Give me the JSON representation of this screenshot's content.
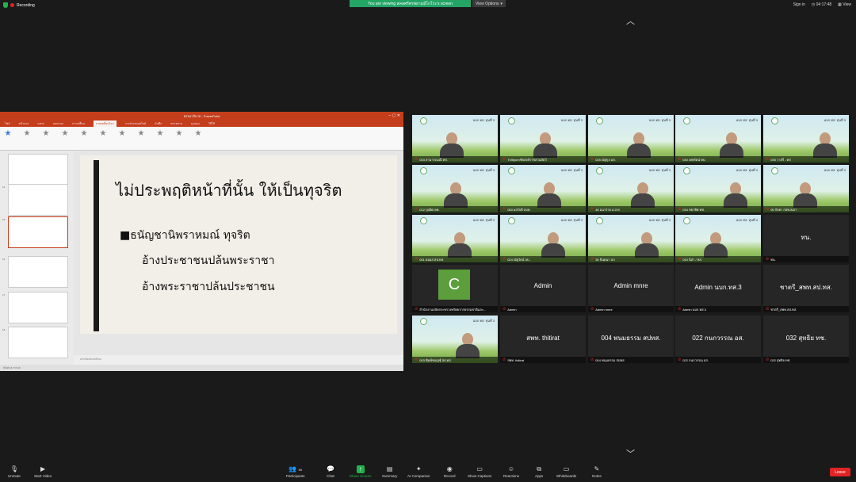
{
  "topbar": {
    "recording": "Recording",
    "viewing": "You are viewing สคสศรีศรพยามมีโกโร่ะ's screen",
    "view_options": "View Options",
    "sign_in": "Sign in",
    "time": "04:17:48",
    "view": "View"
  },
  "ppt": {
    "title": "ธรรมาภิบาล - PowerPoint",
    "tabs": [
      "ไฟล์",
      "หน้าแรก",
      "แทรก",
      "ออกแบบ",
      "การเปลี่ยน",
      "ภาพเคลื่อนไหว",
      "การนำเสนอสไลด์",
      "บันทึก",
      "ตรวจทาน",
      "มุมมอง",
      "วิธีใช้"
    ],
    "active_tab": "ภาพเคลื่อนไหว",
    "thumb_nums": [
      "14",
      "15",
      "16",
      "17",
      "18"
    ],
    "slide_title": "ไม่ประพฤติหน้าที่นั้น ให้เป็นทุจริต",
    "line1": "■ธนัญชานิพราหมณ์ ทุจริต",
    "line2": "อ้างประชาชนปล้นพระราชา",
    "line3": "อ้างพระราชาปล้นประชาชน",
    "notes": "คลิกเพื่อเพิ่มบันทึกย่อ",
    "status": "สไลด์ 16 จาก 20"
  },
  "tiles": [
    {
      "name": "033 สามารถมณี ทส."
    },
    {
      "name": "Thitipornชัยสงค์ราชสวนสัตว์"
    },
    {
      "name": "025 ณัฐกุล อส."
    },
    {
      "name": "040 เทพรัตน์ ทบ."
    },
    {
      "name": "035 วาสรี - ทส"
    },
    {
      "name": "012 บุปผิต คพ."
    },
    {
      "name": "050 ผลใจดี ลบท."
    },
    {
      "name": "46 อนาราย อ.ส.ท"
    },
    {
      "name": "034 ชยาทิศ ทช."
    },
    {
      "name": "05 กัลยา กสพ.ลเลา"
    },
    {
      "name": "001 ยอมส สป.ทส."
    },
    {
      "name": "024 ณัฐวัตน์ ลบ."
    },
    {
      "name": "30 จินตนา ปภ"
    },
    {
      "name": "010 นิสา / ทส."
    },
    {
      "name": "ทน.",
      "center": "ทน."
    },
    {
      "name": "สำนักงานปลัดกระทรวงทรัพยากรธรรมชาติและ...",
      "center": "C"
    },
    {
      "name": "Admin",
      "center": "Admin"
    },
    {
      "name": "Admin mnre",
      "center": "Admin mnre"
    },
    {
      "name": "Admin นบก.ทส.3",
      "center": "Admin นบก.ทส.3"
    },
    {
      "name": "ชาตรี_สพท.สป.ทส.",
      "center": "ชาตรี_สพท.สป.ทส."
    },
    {
      "name": "003 พิมพ์ชนญชุ์ สป.ทส."
    },
    {
      "name": "สพท. thitirat",
      "center": "สพท. thitirat"
    },
    {
      "name": "004 พนมธรรม สปทส.",
      "center": "004 พนมธรรม สปทส."
    },
    {
      "name": "022 กนกวรรณ อส.",
      "center": "022 กนกวรรณ อส."
    },
    {
      "name": "032 สุทธิย ทช.",
      "center": "032 สุทธิย ทช."
    }
  ],
  "tile_header": "นบก.ทส. หุ่นที่ 3",
  "toolbar": {
    "unmute": "Unmute",
    "start_video": "Start Video",
    "participants": "Participants",
    "participants_count": "66",
    "chat": "Chat",
    "share": "Share Screen",
    "summary": "Summary",
    "ai": "AI Companion",
    "record": "Record",
    "captions": "Show Captions",
    "reactions": "Reactions",
    "apps": "Apps",
    "whiteboards": "Whiteboards",
    "notes": "Notes",
    "leave": "Leave"
  }
}
